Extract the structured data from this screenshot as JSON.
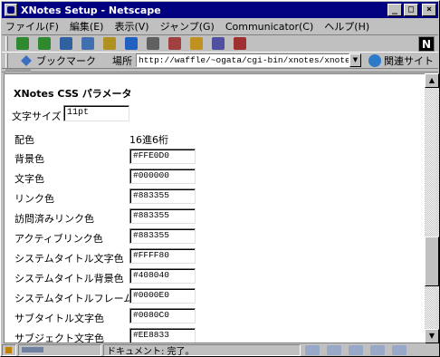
{
  "window": {
    "title": "XNotes Setup - Netscape"
  },
  "title_buttons": {
    "minimize": "_",
    "maximize": "□",
    "close": "×"
  },
  "menu": [
    "ファイル(F)",
    "編集(E)",
    "表示(V)",
    "ジャンプ(G)",
    "Communicator(C)",
    "ヘルプ(H)"
  ],
  "toolbar": {
    "buttons": [
      {
        "name": "back-icon",
        "color": "#2f8a2f"
      },
      {
        "name": "forward-icon",
        "color": "#2f8a2f"
      },
      {
        "name": "reload-icon",
        "color": "#3060a0"
      },
      {
        "name": "home-icon",
        "color": "#4070b0"
      },
      {
        "name": "search-icon",
        "color": "#b09020"
      },
      {
        "name": "guide-icon",
        "color": "#2060c0"
      },
      {
        "name": "print-icon",
        "color": "#606060"
      },
      {
        "name": "images-icon",
        "color": "#a04040"
      },
      {
        "name": "security-icon",
        "color": "#c09020"
      },
      {
        "name": "shop-icon",
        "color": "#5050a0"
      },
      {
        "name": "stop-icon",
        "color": "#a03030"
      }
    ],
    "brand": "N"
  },
  "location": {
    "bookmarks_label": "ブックマーク",
    "location_label": "場所",
    "url": "http://waffle/~ogata/cgi-bin/xnotes/xnotes.cgi",
    "related_label": "関連サイト"
  },
  "content": {
    "heading": "XNotes CSS パラメータ",
    "font_size_label": "文字サイズ",
    "font_size_value": "11pt",
    "color_header_left": "配色",
    "color_header_right": "16進6桁",
    "color_rows": [
      {
        "label": "背景色",
        "value": "#FFE0D0"
      },
      {
        "label": "文字色",
        "value": "#000000"
      },
      {
        "label": "リンク色",
        "value": "#883355"
      },
      {
        "label": "訪問済みリンク色",
        "value": "#883355"
      },
      {
        "label": "アクティブリンク色",
        "value": "#883355"
      },
      {
        "label": "システムタイトル文字色",
        "value": "#FFFF80"
      },
      {
        "label": "システムタイトル背景色",
        "value": "#408040"
      },
      {
        "label": "システムタイトルフレーム色",
        "value": "#0000E0"
      },
      {
        "label": "サブタイトル文字色",
        "value": "#0080C0"
      },
      {
        "label": "サブジェクト文字色",
        "value": "#EE8833"
      }
    ]
  },
  "status": {
    "text": "ドキュメント: 完了。"
  }
}
